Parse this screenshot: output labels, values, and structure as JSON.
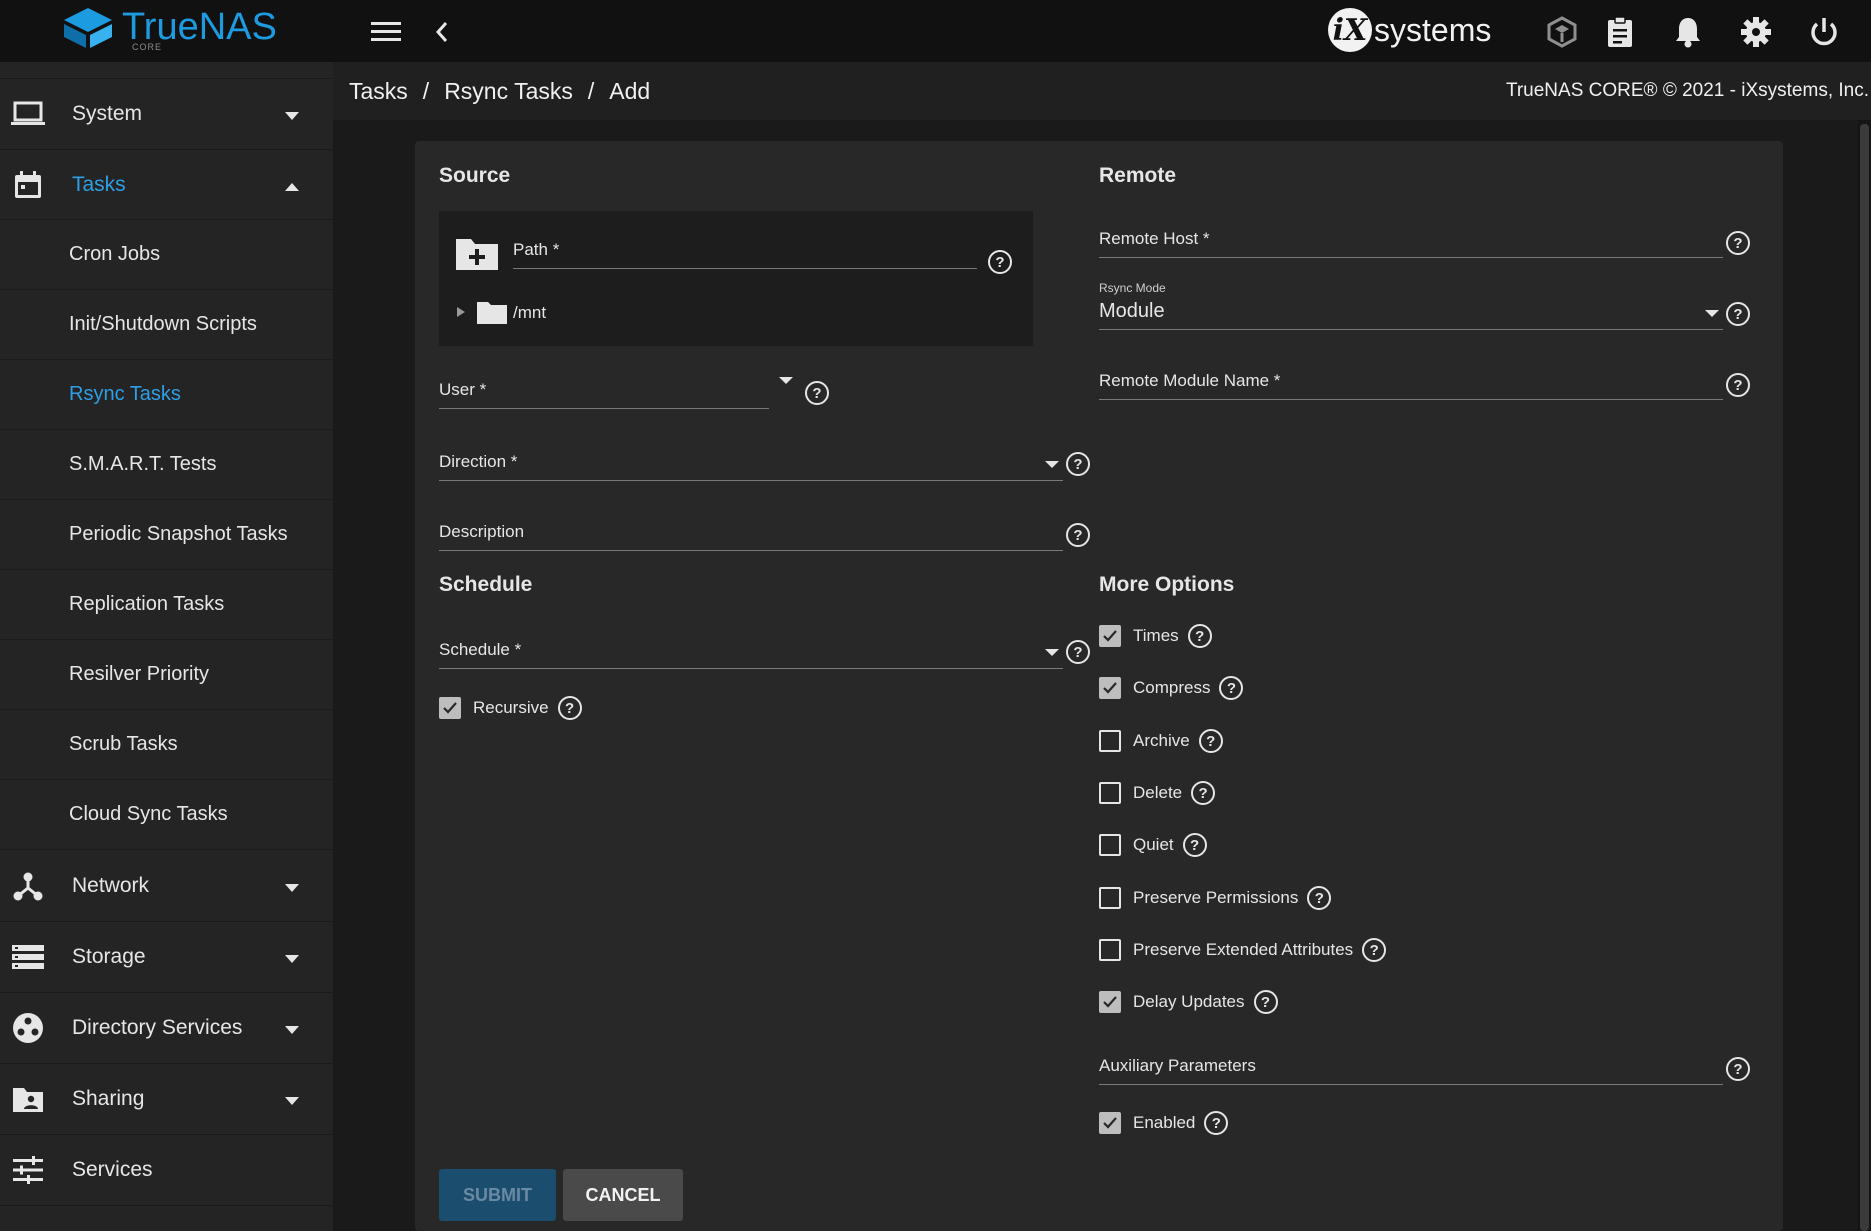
{
  "app": {
    "name": "TrueNAS",
    "edition": "CORE",
    "vendor": "systems"
  },
  "breadcrumb": [
    "Tasks",
    "Rsync Tasks",
    "Add"
  ],
  "copyright": "TrueNAS CORE® © 2021 - iXsystems, Inc.",
  "sidebar": {
    "system": "System",
    "tasks": "Tasks",
    "task_items": [
      "Cron Jobs",
      "Init/Shutdown Scripts",
      "Rsync Tasks",
      "S.M.A.R.T. Tests",
      "Periodic Snapshot Tasks",
      "Replication Tasks",
      "Resilver Priority",
      "Scrub Tasks",
      "Cloud Sync Tasks"
    ],
    "network": "Network",
    "storage": "Storage",
    "directory_services": "Directory Services",
    "sharing": "Sharing",
    "services": "Services"
  },
  "form": {
    "source_title": "Source",
    "path_label": "Path *",
    "tree_root": "/mnt",
    "user_label": "User *",
    "direction_label": "Direction *",
    "description_label": "Description",
    "schedule_title": "Schedule",
    "schedule_label": "Schedule *",
    "recursive_label": "Recursive",
    "remote_title": "Remote",
    "remote_host_label": "Remote Host *",
    "rsync_mode_label": "Rsync Mode",
    "rsync_mode_value": "Module",
    "remote_module_label": "Remote Module Name *",
    "more_options_title": "More Options",
    "options": [
      {
        "label": "Times",
        "checked": true
      },
      {
        "label": "Compress",
        "checked": true
      },
      {
        "label": "Archive",
        "checked": false
      },
      {
        "label": "Delete",
        "checked": false
      },
      {
        "label": "Quiet",
        "checked": false
      },
      {
        "label": "Preserve Permissions",
        "checked": false
      },
      {
        "label": "Preserve Extended Attributes",
        "checked": false
      },
      {
        "label": "Delay Updates",
        "checked": true
      }
    ],
    "aux_label": "Auxiliary Parameters",
    "enabled_label": "Enabled",
    "submit": "SUBMIT",
    "cancel": "CANCEL"
  }
}
